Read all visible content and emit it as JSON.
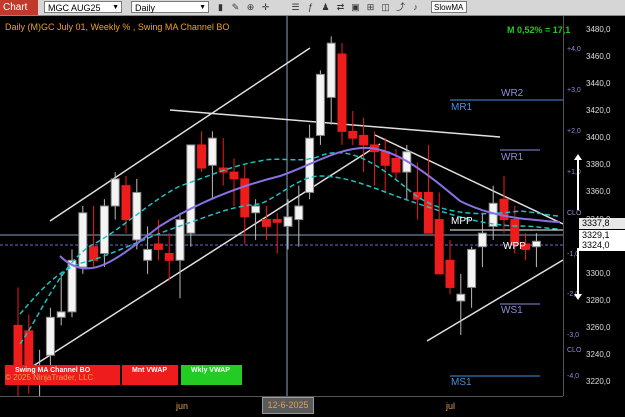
{
  "toolbar": {
    "chart_tab": "Chart",
    "instrument": "MGC AUG25",
    "interval": "Daily",
    "indicator_select": "SlowMA"
  },
  "chart": {
    "title": "Daily (M)GC July 01, Weekly % , Swing MA Channel BO",
    "m_label": "M 0,52% = 17,1",
    "copyright": "© 2025 NinjaTrader, LLC",
    "legend": [
      {
        "label": "Swing MA Channel BO",
        "color": "#ee1c1c"
      },
      {
        "label": "Mnt VWAP",
        "color": "#ee1c1c"
      },
      {
        "label": "Wkly VWAP",
        "color": "#22cc22"
      }
    ],
    "pivot_labels": [
      {
        "text": "WR2",
        "color": "#8e8cd8"
      },
      {
        "text": "MR1",
        "color": "#4a90e2"
      },
      {
        "text": "WR1",
        "color": "#8e8cd8"
      },
      {
        "text": "MPP",
        "color": "#ffffff"
      },
      {
        "text": "WPP",
        "color": "#ffffff"
      },
      {
        "text": "WS1",
        "color": "#8e8cd8"
      },
      {
        "text": "MS1",
        "color": "#4a90e2"
      }
    ]
  },
  "price_axis": {
    "ticks": [
      "3480,0",
      "3460,0",
      "3440,0",
      "3420,0",
      "3400,0",
      "3380,0",
      "3360,0",
      "3340,0",
      "3320,0",
      "3300,0",
      "3280,0",
      "3260,0",
      "3240,0",
      "3220,0"
    ],
    "pct_ticks": [
      "+4,0",
      "+3,0",
      "+2,0",
      "+1,0",
      "-1,0",
      "-2,0",
      "-3,0",
      "-4,0"
    ],
    "clo_label": "CLO",
    "price_tags": [
      {
        "text": "3337,8",
        "bg": "#e8e8e8",
        "fg": "#000000"
      },
      {
        "text": "3329,1",
        "bg": "#ffffff",
        "fg": "#000000"
      },
      {
        "text": "3324,0",
        "bg": "#ffffff",
        "fg": "#000000"
      }
    ]
  },
  "time_axis": {
    "labels": [
      "jun",
      "jul"
    ],
    "crosshair_label": "12-6-2025"
  },
  "chart_data": {
    "type": "candlestick",
    "ylim": [
      3210,
      3490
    ],
    "candles": [
      [
        3262,
        3290,
        3210,
        3220
      ],
      [
        3258,
        3270,
        3212,
        3225
      ],
      [
        3232,
        3244,
        3210,
        3232
      ],
      [
        3240,
        3275,
        3230,
        3268
      ],
      [
        3268,
        3300,
        3262,
        3272
      ],
      [
        3272,
        3318,
        3268,
        3310
      ],
      [
        3305,
        3350,
        3300,
        3345
      ],
      [
        3320,
        3350,
        3305,
        3310
      ],
      [
        3315,
        3355,
        3305,
        3350
      ],
      [
        3350,
        3375,
        3340,
        3370
      ],
      [
        3365,
        3372,
        3330,
        3340
      ],
      [
        3325,
        3370,
        3318,
        3360
      ],
      [
        3310,
        3335,
        3300,
        3318
      ],
      [
        3322,
        3340,
        3310,
        3318
      ],
      [
        3315,
        3330,
        3295,
        3310
      ],
      [
        3310,
        3345,
        3282,
        3340
      ],
      [
        3330,
        3395,
        3320,
        3395
      ],
      [
        3395,
        3405,
        3375,
        3378
      ],
      [
        3380,
        3405,
        3355,
        3400
      ],
      [
        3378,
        3400,
        3365,
        3375
      ],
      [
        3375,
        3385,
        3350,
        3370
      ],
      [
        3370,
        3380,
        3322,
        3342
      ],
      [
        3345,
        3355,
        3325,
        3350
      ],
      [
        3340,
        3350,
        3325,
        3335
      ],
      [
        3340,
        3345,
        3315,
        3338
      ],
      [
        3335,
        3355,
        3318,
        3342
      ],
      [
        3340,
        3365,
        3320,
        3350
      ],
      [
        3360,
        3410,
        3355,
        3400
      ],
      [
        3402,
        3450,
        3395,
        3447
      ],
      [
        3430,
        3475,
        3410,
        3470
      ],
      [
        3462,
        3470,
        3395,
        3405
      ],
      [
        3405,
        3420,
        3395,
        3400
      ],
      [
        3402,
        3415,
        3375,
        3395
      ],
      [
        3395,
        3405,
        3365,
        3390
      ],
      [
        3390,
        3400,
        3360,
        3380
      ],
      [
        3385,
        3392,
        3370,
        3375
      ],
      [
        3375,
        3395,
        3355,
        3390
      ],
      [
        3360,
        3382,
        3340,
        3355
      ],
      [
        3360,
        3395,
        3340,
        3330
      ],
      [
        3340,
        3360,
        3300,
        3300
      ],
      [
        3310,
        3325,
        3285,
        3290
      ],
      [
        3280,
        3300,
        3255,
        3285
      ],
      [
        3290,
        3320,
        3275,
        3318
      ],
      [
        3320,
        3345,
        3305,
        3330
      ],
      [
        3335,
        3365,
        3325,
        3352
      ],
      [
        3355,
        3372,
        3330,
        3340
      ],
      [
        3340,
        3350,
        3315,
        3322
      ],
      [
        3322,
        3330,
        3310,
        3318
      ],
      [
        3320,
        3330,
        3305,
        3324
      ]
    ]
  }
}
